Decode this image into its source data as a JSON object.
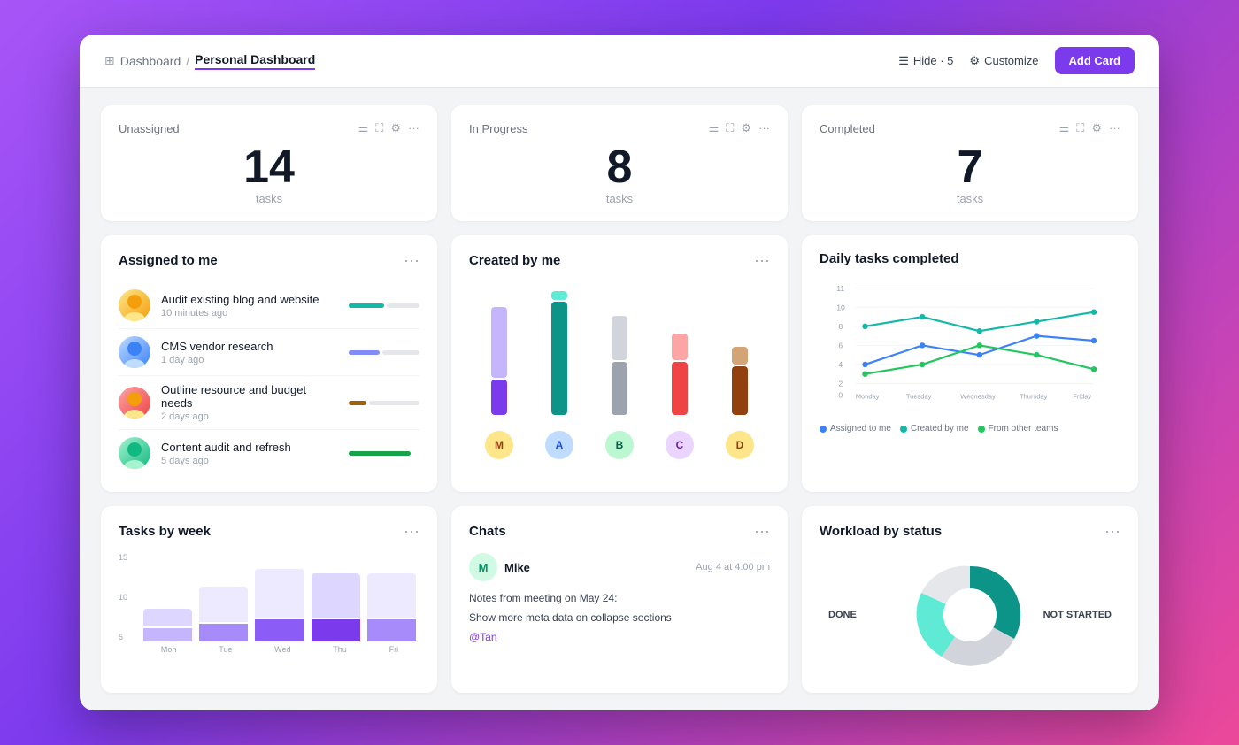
{
  "header": {
    "breadcrumb_parent": "Dashboard",
    "breadcrumb_current": "Personal Dashboard",
    "hide_label": "Hide · 5",
    "customize_label": "Customize",
    "add_card_label": "Add Card"
  },
  "stats": [
    {
      "label": "Unassigned",
      "number": "14",
      "unit": "tasks"
    },
    {
      "label": "In Progress",
      "number": "8",
      "unit": "tasks"
    },
    {
      "label": "Completed",
      "number": "7",
      "unit": "tasks"
    }
  ],
  "assigned_to_me": {
    "title": "Assigned to me",
    "tasks": [
      {
        "name": "Audit existing blog and website",
        "time": "10 minutes ago",
        "bar1": 40,
        "bar2": 70,
        "bar1color": "#14b8a6",
        "bar2color": "#e5e7eb"
      },
      {
        "name": "CMS vendor research",
        "time": "1 day ago",
        "bar1": 50,
        "bar2": 70,
        "bar1color": "#818cf8",
        "bar2color": "#e5e7eb"
      },
      {
        "name": "Outline resource and budget needs",
        "time": "2 days ago",
        "bar1": 20,
        "bar2": 70,
        "bar1color": "#a16207",
        "bar2color": "#e5e7eb"
      },
      {
        "name": "Content audit and refresh",
        "time": "5 days ago",
        "bar1": 70,
        "bar2": 70,
        "bar1color": "#16a34a",
        "bar2color": "#e5e7eb"
      }
    ]
  },
  "created_by_me": {
    "title": "Created by me",
    "bars": [
      {
        "color1": "#c4b5fd",
        "h1": 80,
        "color2": "#7c3aed",
        "h2": 120
      },
      {
        "color1": "#5eead4",
        "h1": 60,
        "color2": "#0d9488",
        "h2": 130
      },
      {
        "color1": "#d1d5db",
        "h1": 40,
        "color2": "#9ca3af",
        "h2": 90
      },
      {
        "color1": "#fca5a5",
        "h1": 30,
        "color2": "#ef4444",
        "h2": 70
      },
      {
        "color1": "#d4a574",
        "h1": 20,
        "color2": "#92400e",
        "h2": 50
      }
    ],
    "people": [
      "M",
      "A",
      "B",
      "C",
      "D"
    ]
  },
  "daily_tasks": {
    "title": "Daily tasks completed",
    "legend": [
      {
        "label": "Assigned to me",
        "color": "#3b82f6"
      },
      {
        "label": "Created by me",
        "color": "#14b8a6"
      },
      {
        "label": "From other teams",
        "color": "#22c55e"
      }
    ],
    "x_labels": [
      "Monday",
      "Tuesday",
      "Wednesday",
      "Thursday",
      "Friday"
    ],
    "y_labels": [
      "11",
      "10",
      "8",
      "6",
      "4",
      "2",
      "0"
    ]
  },
  "tasks_by_week": {
    "title": "Tasks by week",
    "y_labels": [
      "15",
      "10",
      "5"
    ],
    "bars": [
      {
        "seg1": 20,
        "seg2": 10,
        "seg1color": "#c4b5fd",
        "seg2color": "#e9d5ff"
      },
      {
        "seg1": 35,
        "seg2": 15,
        "seg1color": "#a78bfa",
        "seg2color": "#ddd6fe"
      },
      {
        "seg1": 50,
        "seg2": 20,
        "seg1color": "#8b5cf6",
        "seg2color": "#ede9fe"
      },
      {
        "seg1": 45,
        "seg2": 20,
        "seg1color": "#7c3aed",
        "seg2color": "#ddd6fe"
      },
      {
        "seg1": 45,
        "seg2": 22,
        "seg1color": "#a78bfa",
        "seg2color": "#ede9fe"
      }
    ],
    "x_labels": [
      "Mon",
      "Tue",
      "Wed",
      "Thu",
      "Fri"
    ]
  },
  "chats": {
    "title": "Chats",
    "sender": "Mike",
    "date": "Aug 4 at 4:00 pm",
    "lines": [
      "Notes from meeting on May 24:",
      "Show more meta data on collapse sections"
    ],
    "mention": "@Tan"
  },
  "workload": {
    "title": "Workload by status",
    "labels": [
      "DONE",
      "NOT STARTED"
    ]
  }
}
